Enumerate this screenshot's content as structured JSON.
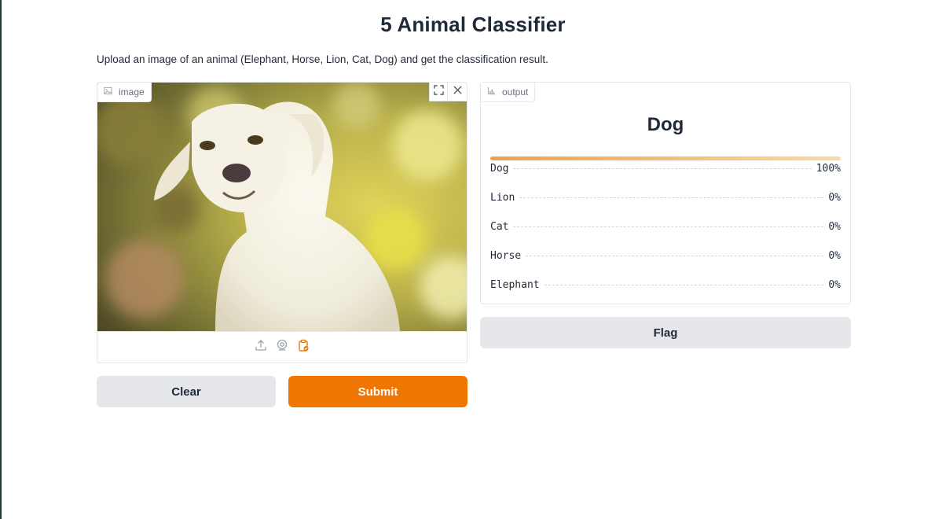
{
  "header": {
    "title": "5 Animal Classifier",
    "description": "Upload an image of an animal (Elephant, Horse, Lion, Cat, Dog) and get the classification result."
  },
  "input": {
    "label": "image",
    "toolbar": {
      "fullscreen_icon": "fullscreen-icon",
      "close_icon": "close-icon"
    },
    "sources": [
      "upload-icon",
      "webcam-icon",
      "clipboard-icon"
    ],
    "active_source": "clipboard",
    "image_content": "dog-photo"
  },
  "output": {
    "label": "output",
    "top_label": "Dog",
    "confidences": [
      {
        "name": "Dog",
        "value": "100%"
      },
      {
        "name": "Lion",
        "value": "0%"
      },
      {
        "name": "Cat",
        "value": "0%"
      },
      {
        "name": "Horse",
        "value": "0%"
      },
      {
        "name": "Elephant",
        "value": "0%"
      }
    ]
  },
  "buttons": {
    "clear": "Clear",
    "submit": "Submit",
    "flag": "Flag"
  },
  "colors": {
    "accent": "#f07604",
    "secondary_button": "#e5e7eb",
    "border": "#e5e7eb"
  }
}
